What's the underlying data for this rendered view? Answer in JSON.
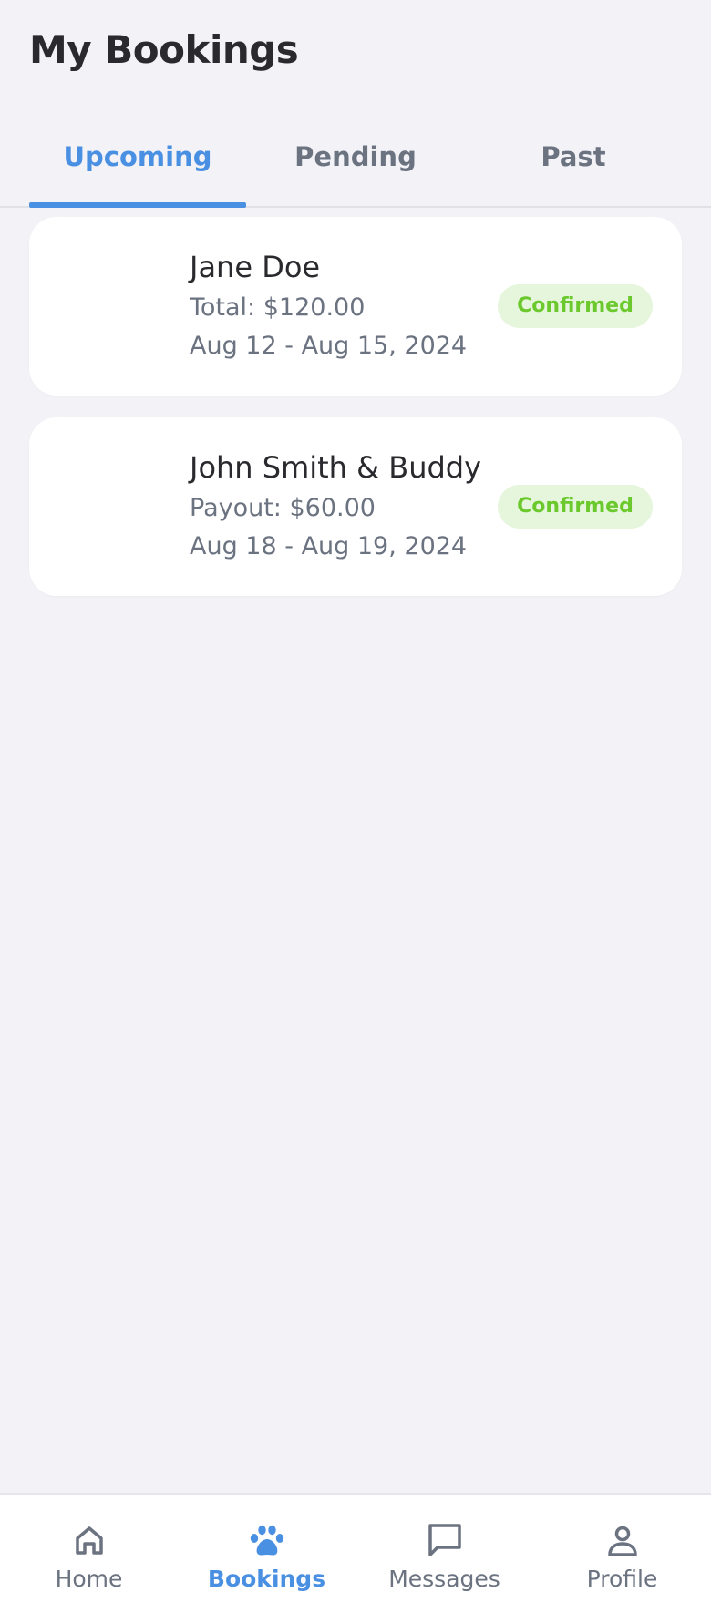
{
  "header": {
    "title": "My Bookings"
  },
  "tabs": [
    {
      "label": "Upcoming",
      "active": true
    },
    {
      "label": "Pending",
      "active": false
    },
    {
      "label": "Past",
      "active": false
    }
  ],
  "bookings": [
    {
      "name": "Jane Doe",
      "amount": "Total: $120.00",
      "dates": "Aug 12 - Aug 15, 2024",
      "status": "Confirmed"
    },
    {
      "name": "John Smith & Buddy",
      "amount": "Payout: $60.00",
      "dates": "Aug 18 - Aug 19, 2024",
      "status": "Confirmed"
    }
  ],
  "bottom_nav": [
    {
      "label": "Home",
      "icon": "home-icon",
      "active": false
    },
    {
      "label": "Bookings",
      "icon": "paw-icon",
      "active": true
    },
    {
      "label": "Messages",
      "icon": "message-icon",
      "active": false
    },
    {
      "label": "Profile",
      "icon": "profile-icon",
      "active": false
    }
  ],
  "colors": {
    "accent": "#4a90e2",
    "background": "#f2f2f7",
    "status_confirmed_text": "#6cc92d",
    "status_confirmed_bg": "#e5f6dc",
    "muted_text": "#6b7280"
  }
}
